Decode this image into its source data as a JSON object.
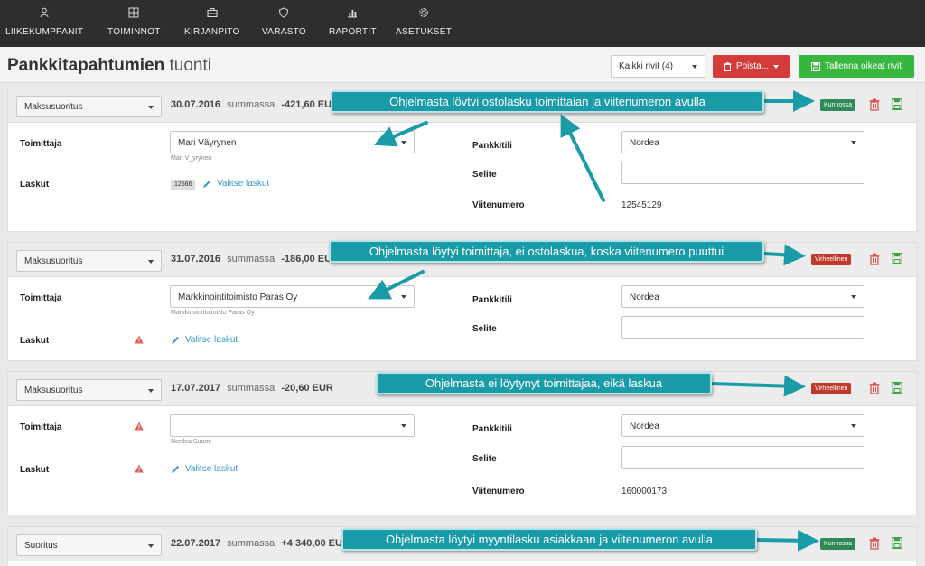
{
  "nav": [
    {
      "label": "LIIKEKUMPPANIT",
      "icon": "person-icon"
    },
    {
      "label": "TOIMINNOT",
      "icon": "grid-icon"
    },
    {
      "label": "KIRJANPITO",
      "icon": "briefcase-icon"
    },
    {
      "label": "VARASTO",
      "icon": "shield-icon"
    },
    {
      "label": "RAPORTIT",
      "icon": "bar-chart-icon"
    },
    {
      "label": "ASETUKSET",
      "icon": "gear-icon"
    }
  ],
  "header": {
    "title_bold": "Pankkitapahtumien",
    "title_light": "tuonti",
    "rows_filter": "Kaikki rivit (4)",
    "delete_label": "Poista...",
    "save_all_label": "Tallenna oikeat rivit"
  },
  "labels": {
    "sum_word": "summassa",
    "supplier": "Toimittaja",
    "invoices": "Laskut",
    "bank_account": "Pankkitili",
    "description": "Selite",
    "reference": "Viitenumero",
    "choose_invoices": "Valitse laskut"
  },
  "rows": [
    {
      "type": "Maksusuoritus",
      "date": "30.07.2016",
      "amount": "-421,60 EUR",
      "status": "Kunnossa",
      "supplier": "Mari Väyrynen",
      "supplier_sub": "Mari V_yrynen",
      "invoice_chip": "12566",
      "bank_account": "Nordea",
      "reference": "12545129",
      "callout": "Ohjelmasta lövtvi ostolasku toimittaian ja viitenumeron avulla"
    },
    {
      "type": "Maksusuoritus",
      "date": "31.07.2016",
      "amount": "-186,00 EUR",
      "status": "Virheellinen",
      "supplier": "Markkinointitoimisto Paras Oy",
      "supplier_sub": "Markkinointitoimisto Paras Oy",
      "bank_account": "Nordea",
      "callout": "Ohjelmasta löytyi toimittaja, ei ostolaskua, koska viitenumero puuttui"
    },
    {
      "type": "Maksusuoritus",
      "date": "17.07.2017",
      "amount": "-20,60 EUR",
      "status": "Virheellinen",
      "supplier": "",
      "supplier_sub": "Nordea Suomi",
      "bank_account": "Nordea",
      "reference": "160000173",
      "callout": "Ohjelmasta ei löytynyt toimittajaa, eikä laskua"
    },
    {
      "type": "Suoritus",
      "date": "22.07.2017",
      "amount": "+4 340,00 EUR",
      "status": "Kunnossa",
      "callout": "Ohjelmasta löytyi myyntilasku asiakkaan ja viitenumeron avulla"
    }
  ],
  "colors": {
    "nav_bg": "#2e2e2e",
    "callout_bg": "#1a9ba8",
    "ok_badge": "#2e8b57",
    "error_badge": "#c0392b",
    "delete_btn": "#d43b3b",
    "save_btn": "#38b63f",
    "link": "#3a97c9"
  }
}
